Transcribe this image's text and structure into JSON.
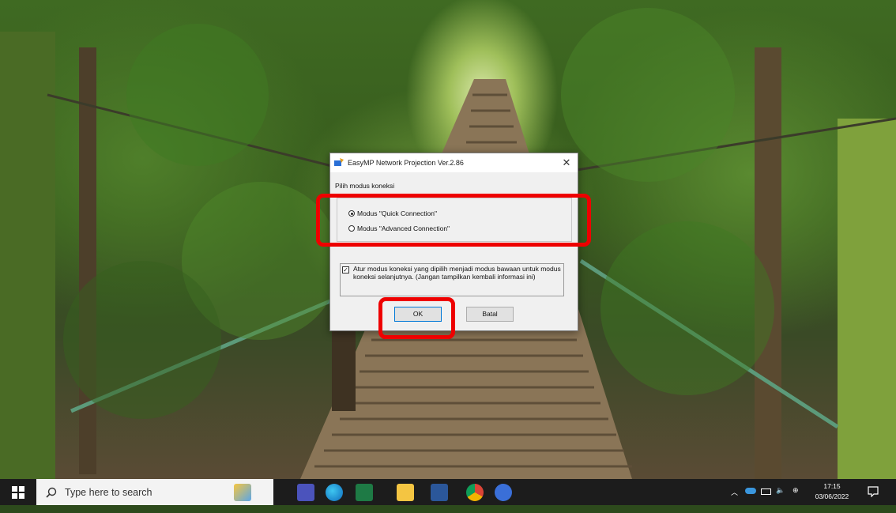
{
  "dialog": {
    "title": "EasyMP Network Projection Ver.2.86",
    "subtitle": "Pilih modus koneksi",
    "options": [
      {
        "label": "Modus \"Quick Connection\"",
        "checked": true
      },
      {
        "label": "Modus \"Advanced Connection\"",
        "checked": false
      }
    ],
    "checkbox_label": "Atur modus koneksi yang dipilih menjadi modus bawaan untuk modus koneksi selanjutnya. (Jangan tampilkan kembali informasi ini)",
    "checkbox_checked": true,
    "ok_label": "OK",
    "cancel_label": "Batal",
    "close_icon": "close-icon"
  },
  "annotations": {
    "color": "#ee0000"
  },
  "taskbar": {
    "search_placeholder": "Type here to search",
    "pinned_icons": [
      "weather-widget-icon",
      "teams-icon",
      "edge-icon",
      "sheets-icon",
      "file-explorer-icon",
      "word-icon",
      "chrome-icon",
      "easymp-icon"
    ],
    "tray_icons": [
      "chevron-up-icon",
      "onedrive-icon",
      "battery-icon",
      "volume-icon",
      "language-icon"
    ],
    "time": "17:15",
    "date": "03/06/2022"
  }
}
